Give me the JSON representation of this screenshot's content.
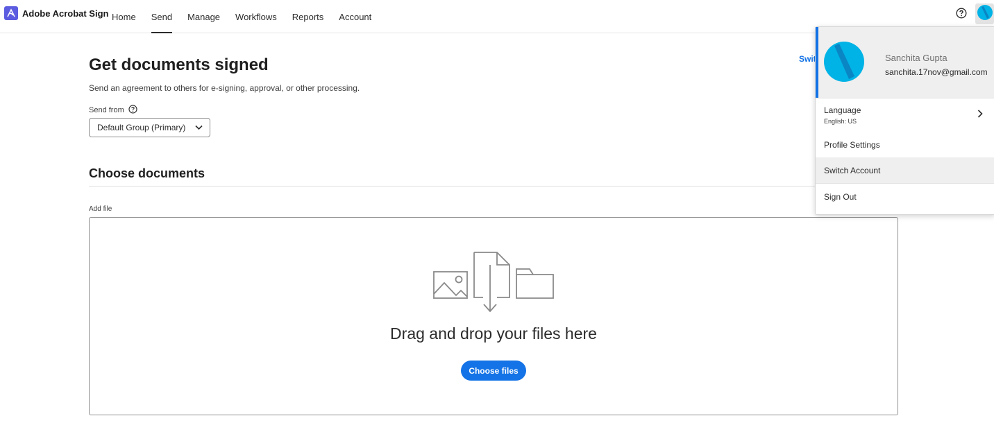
{
  "brand": {
    "name": "Adobe Acrobat Sign"
  },
  "nav": {
    "items": [
      {
        "label": "Home"
      },
      {
        "label": "Send"
      },
      {
        "label": "Manage"
      },
      {
        "label": "Workflows"
      },
      {
        "label": "Reports"
      },
      {
        "label": "Account"
      }
    ],
    "active": "Send"
  },
  "page": {
    "title": "Get documents signed",
    "subtitle": "Send an agreement to others for e-signing, approval, or other processing.",
    "send_from_label": "Send from",
    "send_from_value": "Default Group (Primary)",
    "switch_link": "Swit"
  },
  "documents": {
    "section_title": "Choose documents",
    "add_file_label": "Add file",
    "drop_text": "Drag and drop your files here",
    "choose_button": "Choose files"
  },
  "account_menu": {
    "name": "Sanchita Gupta",
    "email": "sanchita.17nov@gmail.com",
    "language_label": "Language",
    "language_value": "English: US",
    "profile_settings": "Profile Settings",
    "switch_account": "Switch Account",
    "sign_out": "Sign Out"
  },
  "colors": {
    "accent": "#1473e6",
    "brand": "#5c5ce0",
    "avatar": "#00b3e6"
  },
  "icons": [
    "acrobat-logo-icon",
    "help-icon",
    "avatar-icon",
    "chevron-down-icon",
    "image-icon",
    "file-download-icon",
    "folder-icon",
    "chevron-right-icon"
  ]
}
